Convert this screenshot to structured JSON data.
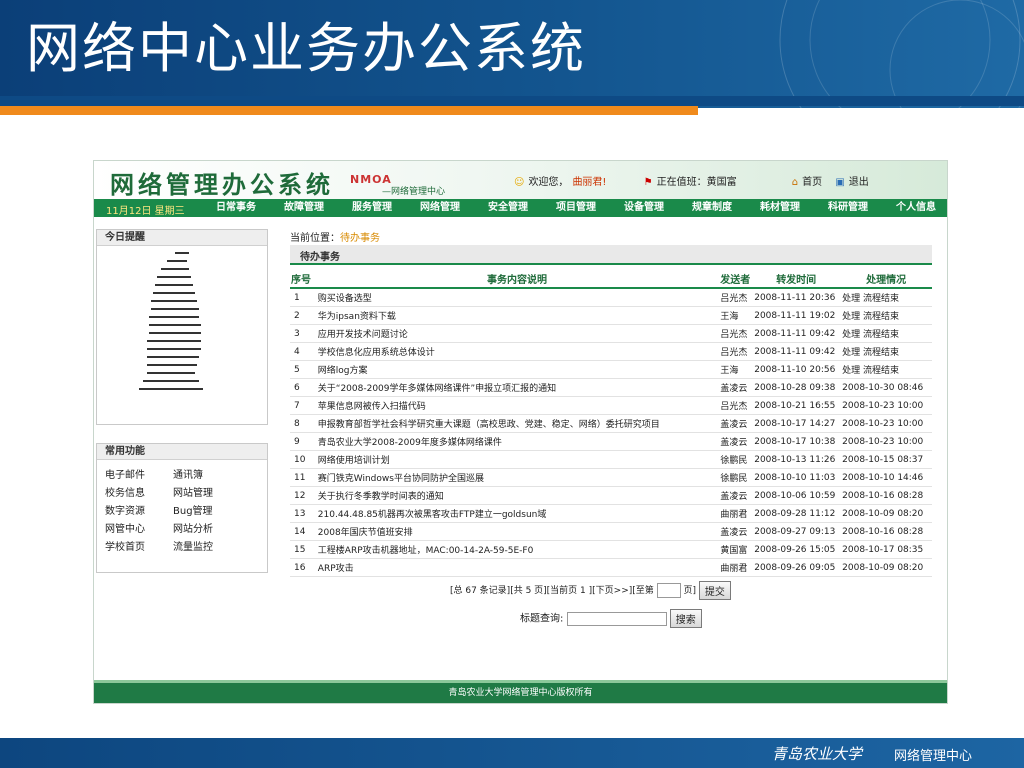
{
  "slide": {
    "title": "网络中心业务办公系统",
    "footer_text": "网络管理中心",
    "school_logo": "青岛农业大学"
  },
  "app": {
    "logo": "网络管理办公系统",
    "nmoa": "NMOA",
    "subtitle": "—网络管理中心",
    "welcome": "欢迎您，",
    "user": "曲丽君!",
    "on_duty": "正在值班：黄国富",
    "home": "首页",
    "logout": "退出"
  },
  "nav": {
    "date": "11月12日  星期三",
    "items": [
      "日常事务",
      "故障管理",
      "服务管理",
      "网络管理",
      "安全管理",
      "项目管理",
      "设备管理",
      "规章制度",
      "耗材管理",
      "科研管理",
      "个人信息"
    ]
  },
  "sidebar": {
    "today_title": "今日提醒",
    "quick_title": "常用功能",
    "quick_links": [
      "电子邮件",
      "通讯簿",
      "校务信息",
      "网站管理",
      "数字资源",
      "Bug管理",
      "网管中心",
      "网站分析",
      "学校首页",
      "流量监控"
    ]
  },
  "main": {
    "breadcrumb_label": "当前位置：",
    "breadcrumb_current": "待办事务",
    "section_title": "待办事务",
    "columns": [
      "序号",
      "事务内容说明",
      "发送者",
      "转发时间",
      "处理情况"
    ],
    "rows": [
      {
        "no": "1",
        "content": "购买设备选型",
        "sender": "吕光杰",
        "time": "2008-11-11 20:36",
        "status": "处理 流程结束"
      },
      {
        "no": "2",
        "content": "华为ipsan资料下载",
        "sender": "王海",
        "time": "2008-11-11 19:02",
        "status": "处理 流程结束"
      },
      {
        "no": "3",
        "content": "应用开发技术问题讨论",
        "sender": "吕光杰",
        "time": "2008-11-11 09:42",
        "status": "处理 流程结束"
      },
      {
        "no": "4",
        "content": "学校信息化应用系统总体设计",
        "sender": "吕光杰",
        "time": "2008-11-11 09:42",
        "status": "处理 流程结束"
      },
      {
        "no": "5",
        "content": "网络log方案",
        "sender": "王海",
        "time": "2008-11-10 20:56",
        "status": "处理 流程结束"
      },
      {
        "no": "6",
        "content": "关于“2008-2009学年多媒体网络课件”申报立项汇报的通知",
        "sender": "盖凌云",
        "time": "2008-10-28 09:38",
        "status": "2008-10-30 08:46"
      },
      {
        "no": "7",
        "content": "苹果信息网被传入扫描代码",
        "sender": "吕光杰",
        "time": "2008-10-21 16:55",
        "status": "2008-10-23 10:00"
      },
      {
        "no": "8",
        "content": "申报教育部哲学社会科学研究重大课题（高校思政、党建、稳定、网络）委托研究项目",
        "sender": "盖凌云",
        "time": "2008-10-17 14:27",
        "status": "2008-10-23 10:00"
      },
      {
        "no": "9",
        "content": "青岛农业大学2008-2009年度多媒体网络课件",
        "sender": "盖凌云",
        "time": "2008-10-17 10:38",
        "status": "2008-10-23 10:00"
      },
      {
        "no": "10",
        "content": "网络使用培训计划",
        "sender": "徐鹏民",
        "time": "2008-10-13 11:26",
        "status": "2008-10-15 08:37"
      },
      {
        "no": "11",
        "content": "赛门铁克Windows平台协同防护全国巡展",
        "sender": "徐鹏民",
        "time": "2008-10-10 11:03",
        "status": "2008-10-10 14:46"
      },
      {
        "no": "12",
        "content": "关于执行冬季教学时间表的通知",
        "sender": "盖凌云",
        "time": "2008-10-06 10:59",
        "status": "2008-10-16 08:28"
      },
      {
        "no": "13",
        "content": "210.44.48.85机器再次被黑客攻击FTP建立一goldsun域",
        "sender": "曲丽君",
        "time": "2008-09-28 11:12",
        "status": "2008-10-09 08:20"
      },
      {
        "no": "14",
        "content": "2008年国庆节值班安排",
        "sender": "盖凌云",
        "time": "2008-09-27 09:13",
        "status": "2008-10-16 08:28"
      },
      {
        "no": "15",
        "content": "工程楼ARP攻击机器地址，MAC:00-14-2A-59-5E-F0",
        "sender": "黄国富",
        "time": "2008-09-26 15:05",
        "status": "2008-10-17 08:35"
      },
      {
        "no": "16",
        "content": "ARP攻击",
        "sender": "曲丽君",
        "time": "2008-09-26 09:05",
        "status": "2008-10-09 08:20"
      }
    ],
    "pager_text": "[总 67 条记录][共 5 页][当前页 1 ][下页>>][至第",
    "pager_page_suffix": "页]",
    "submit_label": "提交",
    "search_label": "标题查询:",
    "search_value": "",
    "search_button": "搜索"
  },
  "footer": {
    "copyright": "青岛农业大学网络管理中心版权所有"
  }
}
